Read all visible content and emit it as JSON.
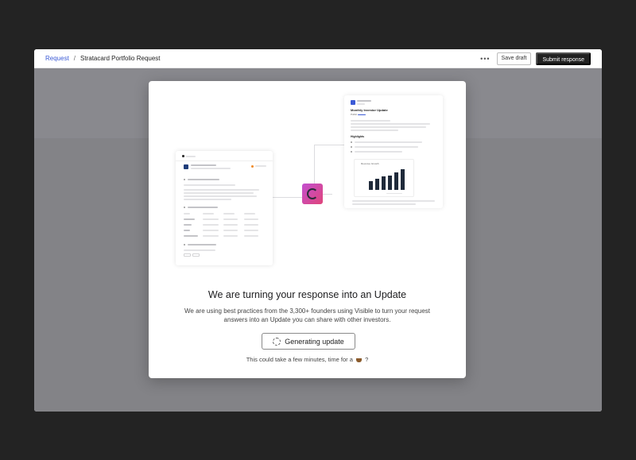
{
  "header": {
    "breadcrumb_link": "Request",
    "breadcrumb_separator": "/",
    "breadcrumb_current": "Stratacard Portfolio Request",
    "more_label": "•••",
    "save_draft_label": "Save draft",
    "submit_label": "Submit response"
  },
  "modal": {
    "title": "We are turning your response into an Update",
    "description": "We are using best practices from the 3,300+ founders using Visible to turn your request answers into an Update you can share with other investors.",
    "generating_label": "Generating update",
    "wait_note_before": "This could take a few minutes, time for a",
    "wait_note_after": "?"
  },
  "illustration": {
    "update_title": "Monthly Investor Update",
    "update_meta": "Public",
    "highlights_label": "Highlights",
    "chart_title": "Revenue Growth",
    "bars": [
      0.35,
      0.45,
      0.55,
      0.6,
      0.72,
      0.85
    ]
  },
  "colors": {
    "accent": "#3c5bd6",
    "submit_button": "#222222",
    "hub_gradient_start": "#c24fd0",
    "hub_gradient_end": "#e0457a"
  }
}
